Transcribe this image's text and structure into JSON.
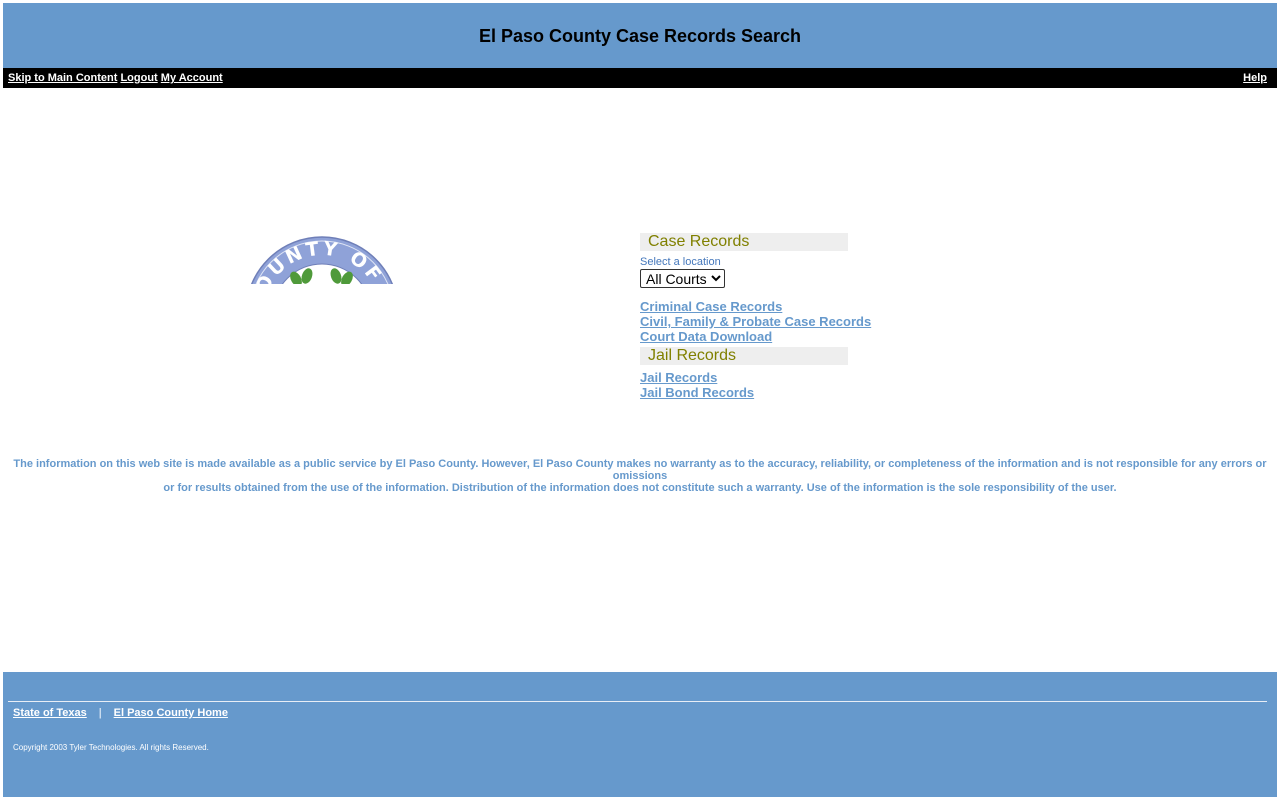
{
  "header": {
    "title": "El Paso County Case Records Search"
  },
  "nav": {
    "skip_link": "Skip to Main Content",
    "logout_link": "Logout",
    "account_link": "My Account",
    "help_link": "Help"
  },
  "seal": {
    "text": "COUNTY OF EL"
  },
  "case_records": {
    "header": "Case Records",
    "location_label": "Select a location",
    "location_selected": "All Courts",
    "links": [
      "Criminal Case Records",
      "Civil, Family & Probate Case Records",
      "Court Data Download"
    ]
  },
  "jail_records": {
    "header": "Jail Records",
    "links": [
      "Jail Records",
      "Jail Bond Records"
    ]
  },
  "disclaimer": {
    "line1": "The information on this web site is made available as a public service by El Paso County. However, El Paso County makes no warranty as to the accuracy, reliability, or completeness of the information and is not responsible for any errors or omissions",
    "line2": "or for results obtained from the use of the information. Distribution of the information does not constitute such a warranty. Use of the information is the sole responsibility of the user."
  },
  "footer": {
    "link1": "State of Texas",
    "separator": "|",
    "link2": "El Paso County Home",
    "copyright": "Copyright 2003 Tyler Technologies. All rights Reserved."
  },
  "colors": {
    "header_bg": "#6699cc",
    "nav_bg": "#000000",
    "link": "#6699cc",
    "section_header_text": "#808000",
    "section_header_bg": "#eeeeee"
  }
}
